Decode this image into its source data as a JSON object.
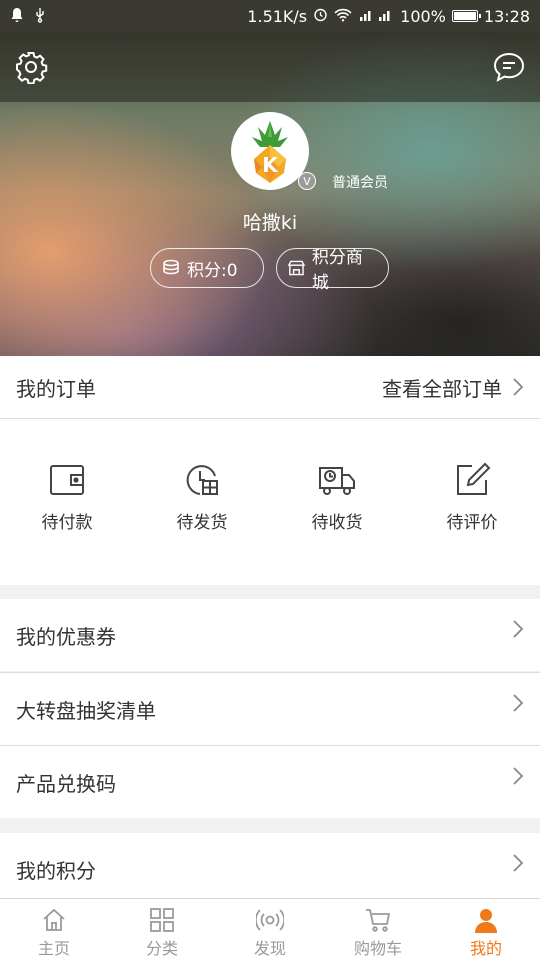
{
  "status_bar": {
    "speed": "1.51K/s",
    "battery": "100%",
    "battery_level": 1.0,
    "time": "13:28"
  },
  "header": {
    "member_level": "普通会员",
    "vip_badge": "V",
    "avatar_letter": "K",
    "username": "哈撒ki",
    "points_label": "积分:0",
    "mall_label": "积分商城"
  },
  "orders": {
    "title": "我的订单",
    "view_all": "查看全部订单",
    "items": [
      {
        "label": "待付款",
        "icon": "wallet-icon"
      },
      {
        "label": "待发货",
        "icon": "pending-ship-icon"
      },
      {
        "label": "待收货",
        "icon": "delivery-truck-icon"
      },
      {
        "label": "待评价",
        "icon": "review-edit-icon"
      }
    ]
  },
  "menu": {
    "coupons": "我的优惠券",
    "wheel_list": "大转盘抽奖清单",
    "redeem_code": "产品兑换码",
    "my_points": "我的积分"
  },
  "nav": {
    "items": [
      {
        "label": "主页",
        "icon": "home-icon"
      },
      {
        "label": "分类",
        "icon": "grid-icon"
      },
      {
        "label": "发现",
        "icon": "radar-icon"
      },
      {
        "label": "购物车",
        "icon": "cart-icon"
      },
      {
        "label": "我的",
        "icon": "person-icon"
      }
    ],
    "active_index": 4
  },
  "colors": {
    "accent": "#f07a1a",
    "nav_inactive": "#9a9a9a",
    "page_bg": "#f1f1f1"
  }
}
